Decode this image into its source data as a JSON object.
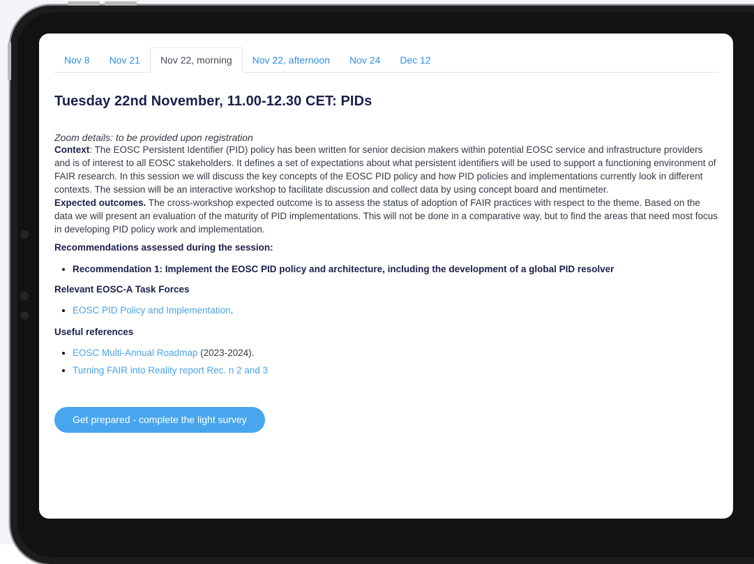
{
  "tabs": [
    {
      "label": "Nov 8"
    },
    {
      "label": "Nov 21"
    },
    {
      "label": "Nov 22, morning"
    },
    {
      "label": "Nov 22, afternoon"
    },
    {
      "label": "Nov 24"
    },
    {
      "label": "Dec 12"
    }
  ],
  "active_tab": "Nov 22, morning",
  "session": {
    "title": "Tuesday 22nd November, 11.00-12.30 CET: PIDs",
    "zoom": "Zoom details: to be provided upon registration",
    "context_label": "Context",
    "context_text": ": The EOSC Persistent Identifier (PID) policy has been written for senior decision makers within potential EOSC service and infrastructure providers and is of interest to all EOSC stakeholders. It defines a set of expectations about what persistent identifiers will be used to support a functioning environment of FAIR research. In this session we will discuss the key concepts of the EOSC PID policy and how PID policies and implementations currently look in different contexts. The session will be an interactive workshop to facilitate discussion and collect data by using concept board and mentimeter.",
    "outcomes_label": "Expected outcomes.",
    "outcomes_text": " The cross-workshop expected outcome is to assess the status of adoption of FAIR practices with respect to the theme. Based on the data we will present an evaluation of the maturity of PID implementations. This will not be done in a comparative way, but to find the areas that need most focus in developing PID policy work and implementation."
  },
  "recommendations": {
    "heading": "Recommendations assessed during the session:",
    "items": [
      "Recommendation 1: Implement the EOSC PID policy and architecture, including the development of a global PID resolver"
    ]
  },
  "task_forces": {
    "heading": "Relevant EOSC-A Task Forces",
    "items": [
      {
        "link": "EOSC PID Policy and Implementation",
        "suffix": "."
      }
    ]
  },
  "references": {
    "heading": "Useful references",
    "items": [
      {
        "link": "EOSC Multi-Annual Roadmap",
        "suffix": " (2023-2024)."
      },
      {
        "link": "Turning FAIR into Reality report  Rec. n 2 and 3",
        "suffix": ""
      }
    ]
  },
  "cta": {
    "label": "Get prepared - complete the light survey"
  },
  "colors": {
    "link": "#4aa3ea",
    "tab_link": "#2f8de8",
    "heading": "#1b1f4b",
    "button": "#48a6ee",
    "device_frame": "#1c1c1e"
  }
}
